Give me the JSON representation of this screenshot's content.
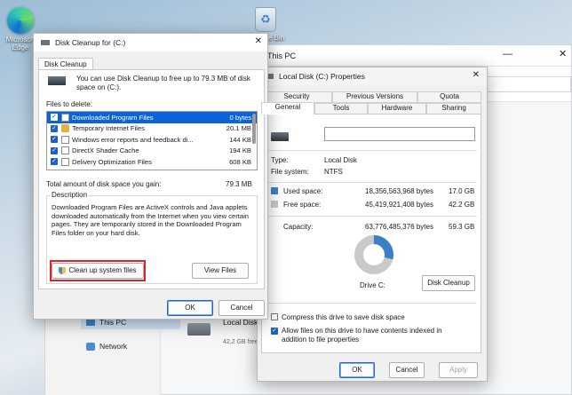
{
  "desktop": {
    "edge_label": "Microsoft Edge",
    "bin_label": "Recycle Bin"
  },
  "explorer": {
    "title": "This PC",
    "nav": [
      {
        "label": "This PC",
        "icon": "computer-icon"
      },
      {
        "label": "Network",
        "icon": "network-icon"
      }
    ],
    "drive_name": "Local Disk",
    "drive_free": "42,2 GB free"
  },
  "cleanup": {
    "title": "Disk Cleanup for  (C:)",
    "tab": "Disk Cleanup",
    "intro": "You can use Disk Cleanup to free up to 79.3 MB of disk space on  (C:).",
    "files_label": "Files to delete:",
    "files": [
      {
        "name": "Downloaded Program Files",
        "size": "0 bytes",
        "selected": true
      },
      {
        "name": "Temporary Internet Files",
        "size": "20.1 MB",
        "selected": false
      },
      {
        "name": "Windows error reports and feedback di...",
        "size": "144 KB",
        "selected": false
      },
      {
        "name": "DirectX Shader Cache",
        "size": "194 KB",
        "selected": false
      },
      {
        "name": "Delivery Optimization Files",
        "size": "608 KB",
        "selected": false
      }
    ],
    "total_label": "Total amount of disk space you gain:",
    "total_value": "79.3 MB",
    "description_label": "Description",
    "description": "Downloaded Program Files are ActiveX controls and Java applets downloaded automatically from the Internet when you view certain pages. They are temporarily stored in the Downloaded Program Files folder on your hard disk.",
    "cleanup_system_button": "Clean up system files",
    "view_files_button": "View Files",
    "ok": "OK",
    "cancel": "Cancel",
    "highlight_color": "#e02424"
  },
  "props": {
    "title": "Local Disk (C:) Properties",
    "tabs_top": [
      "Security",
      "Previous Versions",
      "Quota"
    ],
    "tabs_bottom": [
      "General",
      "Tools",
      "Hardware",
      "Sharing"
    ],
    "type_label": "Type:",
    "type_value": "Local Disk",
    "fs_label": "File system:",
    "fs_value": "NTFS",
    "used_label": "Used space:",
    "used_bytes": "18,356,563,968 bytes",
    "used_gb": "17.0 GB",
    "free_label": "Free space:",
    "free_bytes": "45,419,921,408 bytes",
    "free_gb": "42.2 GB",
    "capacity_label": "Capacity:",
    "capacity_bytes": "63,776,485,376 bytes",
    "capacity_gb": "59.3 GB",
    "drive_label": "Drive C:",
    "disk_cleanup_button": "Disk Cleanup",
    "compress_label": "Compress this drive to save disk space",
    "index_label": "Allow files on this drive to have contents indexed in addition to file properties",
    "ok": "OK",
    "cancel": "Cancel",
    "apply": "Apply",
    "used_color": "#3b7fc4",
    "free_color": "#c9c9c9",
    "used_fraction": 0.288
  }
}
